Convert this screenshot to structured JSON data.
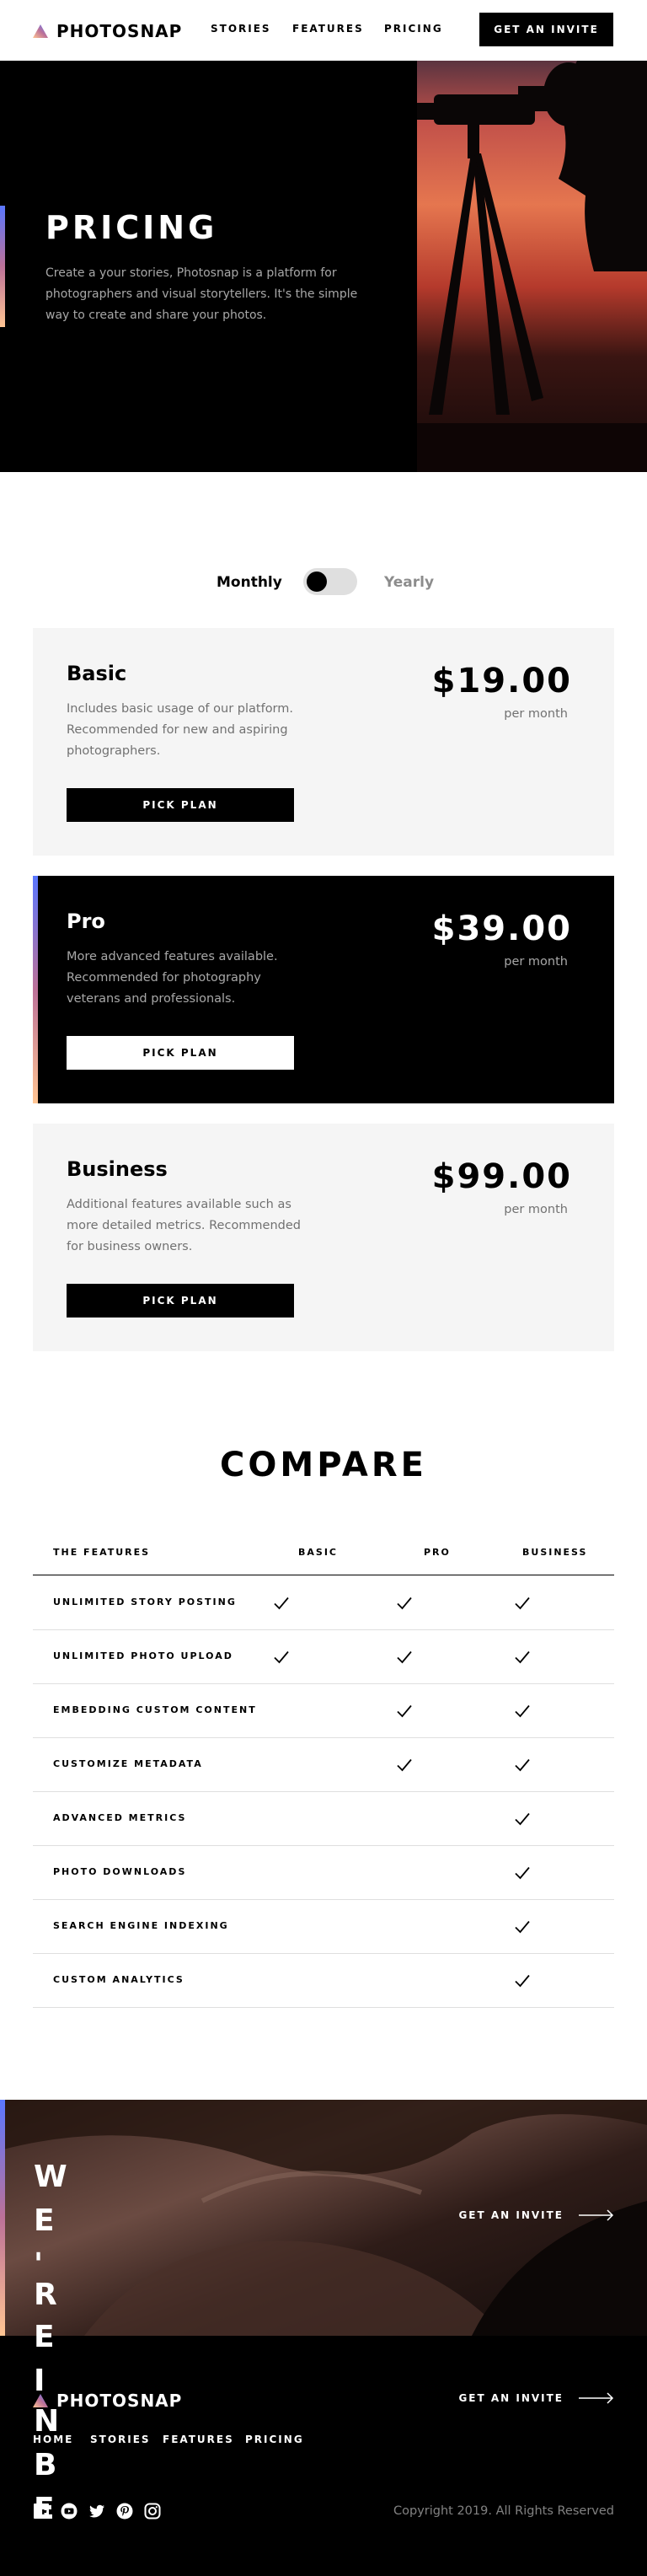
{
  "brand": {
    "name": "PHOTOSNAP",
    "logo_icon": "triangle-logo-icon"
  },
  "nav": {
    "links": [
      "STORIES",
      "FEATURES",
      "PRICING"
    ],
    "cta": "GET AN INVITE"
  },
  "hero": {
    "title": "PRICING",
    "description": "Create a your stories, Photosnap is a platform for photographers and visual storytellers. It's the simple way to create and share your photos."
  },
  "billing_toggle": {
    "monthly": "Monthly",
    "yearly": "Yearly",
    "selected": "Monthly"
  },
  "plans": [
    {
      "name": "Basic",
      "description": "Includes basic usage of our platform. Recommended for new and aspiring photographers.",
      "price": "$19.00",
      "period": "per month",
      "button": "PICK PLAN"
    },
    {
      "name": "Pro",
      "description": "More advanced features available. Recommended for photography veterans and professionals.",
      "price": "$39.00",
      "period": "per month",
      "button": "PICK PLAN"
    },
    {
      "name": "Business",
      "description": "Additional features available such as more detailed metrics. Recommended for business owners.",
      "price": "$99.00",
      "period": "per month",
      "button": "PICK PLAN"
    }
  ],
  "compare": {
    "title": "COMPARE",
    "headers": [
      "THE FEATURES",
      "BASIC",
      "PRO",
      "BUSINESS"
    ],
    "rows": [
      {
        "feature": "UNLIMITED STORY POSTING",
        "basic": true,
        "pro": true,
        "business": true
      },
      {
        "feature": "UNLIMITED PHOTO UPLOAD",
        "basic": true,
        "pro": true,
        "business": true
      },
      {
        "feature": "EMBEDDING CUSTOM CONTENT",
        "basic": false,
        "pro": true,
        "business": true
      },
      {
        "feature": "CUSTOMIZE METADATA",
        "basic": false,
        "pro": true,
        "business": true
      },
      {
        "feature": "ADVANCED METRICS",
        "basic": false,
        "pro": false,
        "business": true
      },
      {
        "feature": "PHOTO DOWNLOADS",
        "basic": false,
        "pro": false,
        "business": true
      },
      {
        "feature": "SEARCH ENGINE INDEXING",
        "basic": false,
        "pro": false,
        "business": true
      },
      {
        "feature": "CUSTOM ANALYTICS",
        "basic": false,
        "pro": false,
        "business": true
      }
    ]
  },
  "beta": {
    "letters": [
      "W",
      "E",
      "'",
      "R",
      "E",
      "I",
      "N",
      "B",
      "E"
    ],
    "cta": "GET AN INVITE"
  },
  "footer": {
    "brand": "PHOTOSNAP",
    "links": [
      "HOME",
      "STORIES",
      "FEATURES",
      "PRICING"
    ],
    "cta": "GET AN INVITE",
    "social_icons": [
      "facebook-icon",
      "youtube-icon",
      "twitter-icon",
      "pinterest-icon",
      "instagram-icon"
    ],
    "copyright": "Copyright 2019. All Rights Reserved"
  },
  "colors": {
    "accent_start": "#5a77ff",
    "accent_mid": "#bc7198",
    "accent_end": "#ffc593",
    "card_light": "#f5f5f5",
    "dark": "#000000"
  }
}
